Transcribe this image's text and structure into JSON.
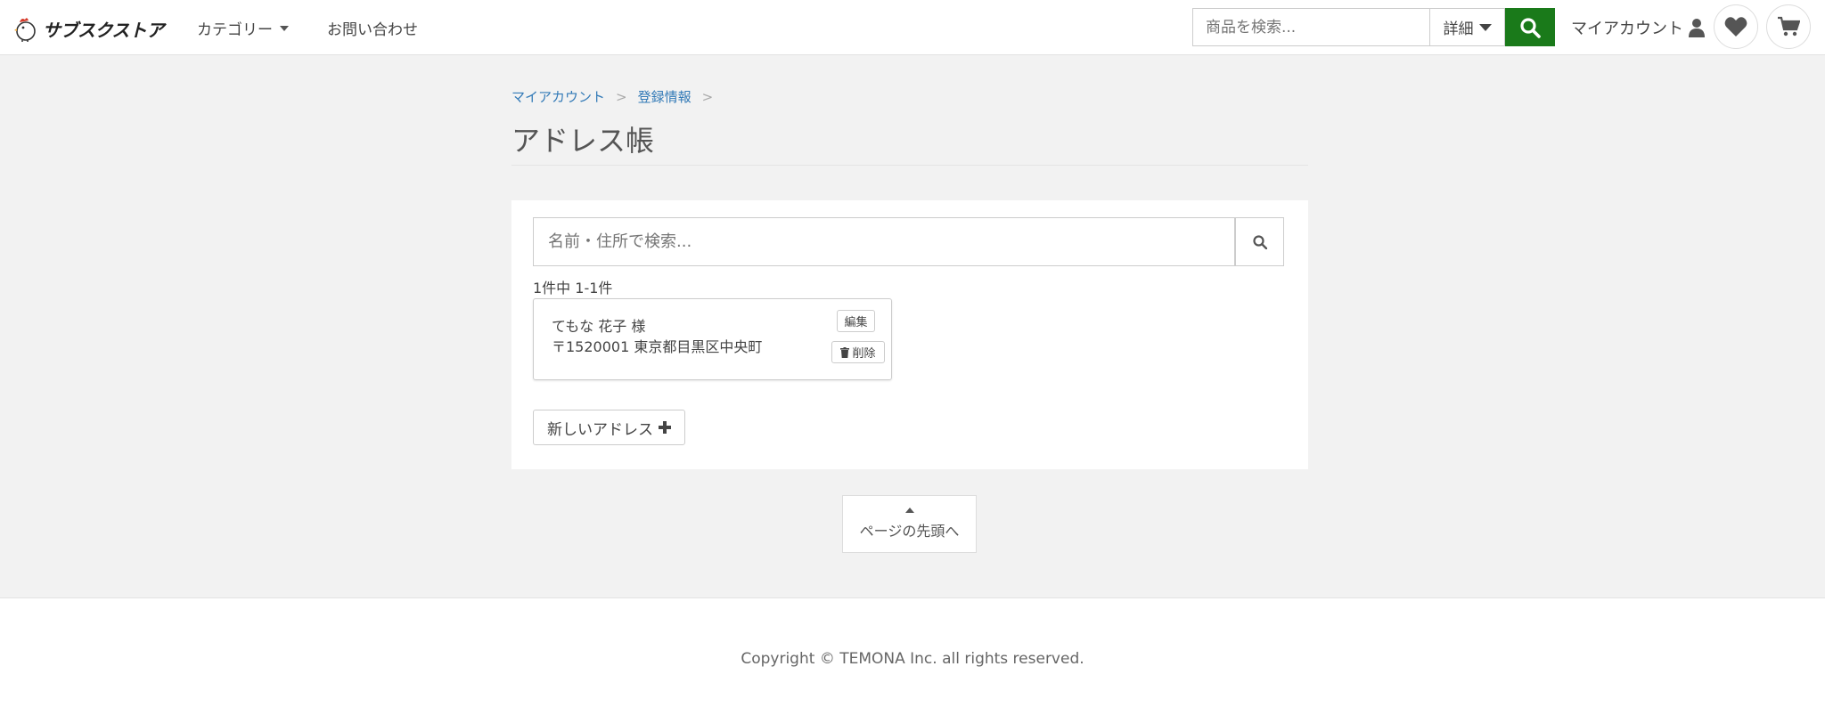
{
  "header": {
    "logo_text": "サブスクストア",
    "nav": {
      "category": "カテゴリー",
      "contact": "お問い合わせ"
    },
    "search": {
      "placeholder": "商品を検索...",
      "detail_label": "詳細"
    },
    "myaccount": "マイアカウント"
  },
  "breadcrumb": {
    "items": [
      "マイアカウント",
      "登録情報"
    ],
    "separator": ">"
  },
  "page_title": "アドレス帳",
  "address_search": {
    "placeholder": "名前・住所で検索..."
  },
  "result_count": "1件中 1-1件",
  "addresses": [
    {
      "name": "てもな 花子 様",
      "address": "〒1520001 東京都目黒区中央町",
      "edit_label": "編集",
      "delete_label": "削除"
    }
  ],
  "new_address_label": "新しいアドレス",
  "page_top_label": "ページの先頭へ",
  "footer": {
    "copyright": "Copyright © TEMONA Inc. all rights reserved."
  },
  "colors": {
    "accent": "#1a7a1a",
    "link": "#337ab7"
  }
}
